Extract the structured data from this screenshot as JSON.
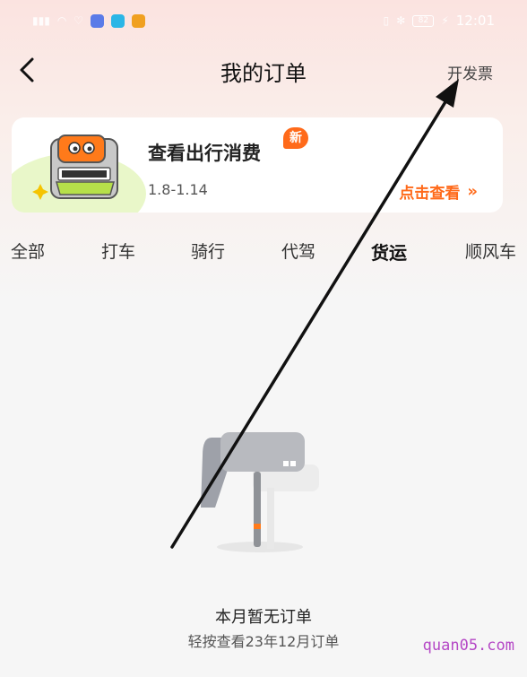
{
  "status_bar": {
    "time": "12:01",
    "battery": "82"
  },
  "nav": {
    "title": "我的订单",
    "action": "开发票"
  },
  "banner": {
    "title": "查看出行消费",
    "date_range": "1.8-1.14",
    "badge": "新",
    "link": "点击查看"
  },
  "tabs": [
    {
      "label": "全部"
    },
    {
      "label": "打车"
    },
    {
      "label": "骑行"
    },
    {
      "label": "代驾"
    },
    {
      "label": "货运",
      "active": true
    },
    {
      "label": "顺风车"
    }
  ],
  "empty_state": {
    "title": "本月暂无订单",
    "subtitle": "轻按查看23年12月订单"
  },
  "watermark": "quan05.com",
  "colors": {
    "accent": "#ff6a1a",
    "header_bg": "#fbe3e0",
    "page_bg": "#f6f6f6"
  }
}
